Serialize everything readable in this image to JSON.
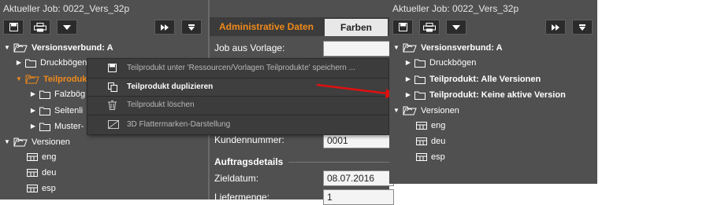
{
  "left_panel": {
    "title": "Aktueller Job: 0022_Vers_32p",
    "tree": [
      {
        "label": "Versionsverbund: A"
      },
      {
        "label": "Druckbögen"
      },
      {
        "label": "Teilprodukt"
      },
      {
        "label": "Falzbög"
      },
      {
        "label": "Seitenli"
      },
      {
        "label": "Muster-"
      },
      {
        "label": "Versionen"
      },
      {
        "label": "eng"
      },
      {
        "label": "deu"
      },
      {
        "label": "esp"
      }
    ]
  },
  "middle_panel": {
    "tabs": [
      {
        "label": "Administrative Daten"
      },
      {
        "label": "Farben"
      }
    ],
    "fields": {
      "job_template_label": "Job aus Vorlage:",
      "customer_number_label": "Kundennummer:",
      "customer_number_value": "0001",
      "section_order": "Auftragsdetails",
      "target_date_label": "Zieldatum:",
      "target_date_value": "08.07.2016",
      "quantity_label": "Liefermenge:",
      "quantity_value": "1"
    }
  },
  "context_menu": {
    "items": [
      {
        "label": "Teilprodukt unter 'Ressourcen/Vorlagen Teilprodukte' speichern ..."
      },
      {
        "label": "Teilprodukt duplizieren"
      },
      {
        "label": "Teilprodukt löschen"
      },
      {
        "label": "3D Flattermarken-Darstellung"
      }
    ]
  },
  "right_panel": {
    "title": "Aktueller Job: 0022_Vers_32p",
    "tree": [
      {
        "label": "Versionsverbund: A"
      },
      {
        "label": "Druckbögen"
      },
      {
        "label": "Teilprodukt: Alle Versionen"
      },
      {
        "label": "Teilprodukt: Keine aktive Version"
      },
      {
        "label": "Versionen"
      },
      {
        "label": "eng"
      },
      {
        "label": "deu"
      },
      {
        "label": "esp"
      }
    ]
  },
  "colors": {
    "panel_bg": "#505050",
    "accent_orange": "#f08a1a",
    "arrow_red": "#e01010"
  }
}
